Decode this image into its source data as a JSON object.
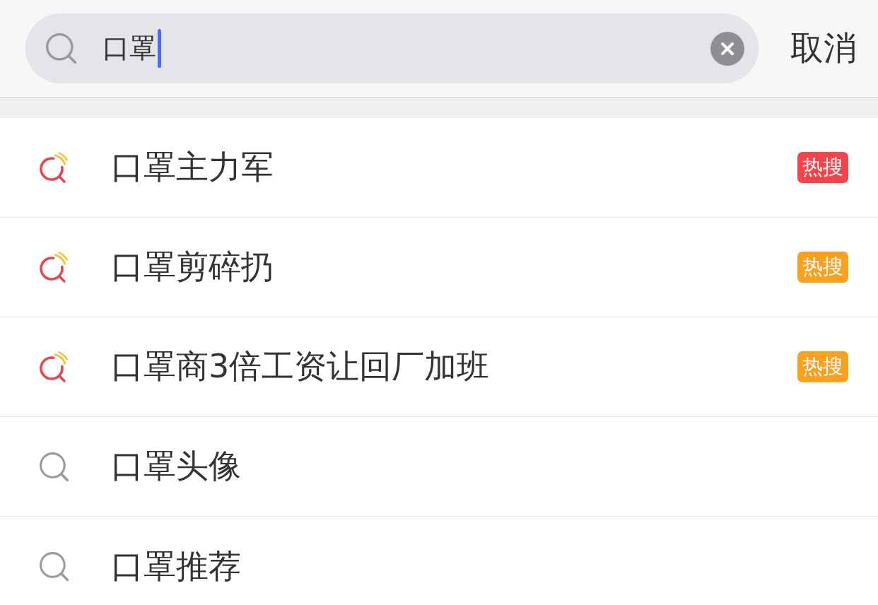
{
  "search": {
    "value": "口罩",
    "focused": true,
    "cancel_label": "取消"
  },
  "suggestions": [
    {
      "kind": "trending",
      "text": "口罩主力军",
      "badge": {
        "label": "热搜",
        "color": "#f4434a"
      }
    },
    {
      "kind": "trending",
      "text": "口罩剪碎扔",
      "badge": {
        "label": "热搜",
        "color": "#f9a01f"
      }
    },
    {
      "kind": "trending",
      "text": "口罩商3倍工资让回厂加班",
      "badge": {
        "label": "热搜",
        "color": "#f9a01f"
      }
    },
    {
      "kind": "plain",
      "text": "口罩头像"
    },
    {
      "kind": "plain",
      "text": "口罩推荐"
    }
  ]
}
